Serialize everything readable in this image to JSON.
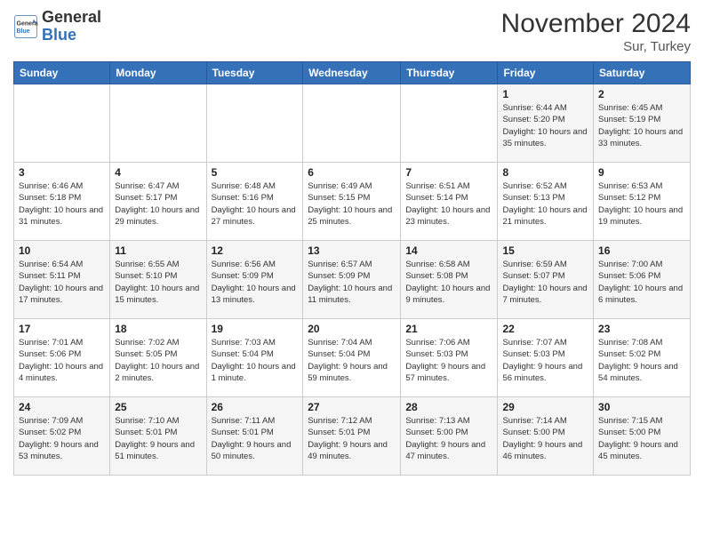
{
  "header": {
    "logo_line1": "General",
    "logo_line2": "Blue",
    "month": "November 2024",
    "location": "Sur, Turkey"
  },
  "calendar": {
    "days_of_week": [
      "Sunday",
      "Monday",
      "Tuesday",
      "Wednesday",
      "Thursday",
      "Friday",
      "Saturday"
    ],
    "weeks": [
      [
        {
          "day": "",
          "info": ""
        },
        {
          "day": "",
          "info": ""
        },
        {
          "day": "",
          "info": ""
        },
        {
          "day": "",
          "info": ""
        },
        {
          "day": "",
          "info": ""
        },
        {
          "day": "1",
          "info": "Sunrise: 6:44 AM\nSunset: 5:20 PM\nDaylight: 10 hours\nand 35 minutes."
        },
        {
          "day": "2",
          "info": "Sunrise: 6:45 AM\nSunset: 5:19 PM\nDaylight: 10 hours\nand 33 minutes."
        }
      ],
      [
        {
          "day": "3",
          "info": "Sunrise: 6:46 AM\nSunset: 5:18 PM\nDaylight: 10 hours\nand 31 minutes."
        },
        {
          "day": "4",
          "info": "Sunrise: 6:47 AM\nSunset: 5:17 PM\nDaylight: 10 hours\nand 29 minutes."
        },
        {
          "day": "5",
          "info": "Sunrise: 6:48 AM\nSunset: 5:16 PM\nDaylight: 10 hours\nand 27 minutes."
        },
        {
          "day": "6",
          "info": "Sunrise: 6:49 AM\nSunset: 5:15 PM\nDaylight: 10 hours\nand 25 minutes."
        },
        {
          "day": "7",
          "info": "Sunrise: 6:51 AM\nSunset: 5:14 PM\nDaylight: 10 hours\nand 23 minutes."
        },
        {
          "day": "8",
          "info": "Sunrise: 6:52 AM\nSunset: 5:13 PM\nDaylight: 10 hours\nand 21 minutes."
        },
        {
          "day": "9",
          "info": "Sunrise: 6:53 AM\nSunset: 5:12 PM\nDaylight: 10 hours\nand 19 minutes."
        }
      ],
      [
        {
          "day": "10",
          "info": "Sunrise: 6:54 AM\nSunset: 5:11 PM\nDaylight: 10 hours\nand 17 minutes."
        },
        {
          "day": "11",
          "info": "Sunrise: 6:55 AM\nSunset: 5:10 PM\nDaylight: 10 hours\nand 15 minutes."
        },
        {
          "day": "12",
          "info": "Sunrise: 6:56 AM\nSunset: 5:09 PM\nDaylight: 10 hours\nand 13 minutes."
        },
        {
          "day": "13",
          "info": "Sunrise: 6:57 AM\nSunset: 5:09 PM\nDaylight: 10 hours\nand 11 minutes."
        },
        {
          "day": "14",
          "info": "Sunrise: 6:58 AM\nSunset: 5:08 PM\nDaylight: 10 hours\nand 9 minutes."
        },
        {
          "day": "15",
          "info": "Sunrise: 6:59 AM\nSunset: 5:07 PM\nDaylight: 10 hours\nand 7 minutes."
        },
        {
          "day": "16",
          "info": "Sunrise: 7:00 AM\nSunset: 5:06 PM\nDaylight: 10 hours\nand 6 minutes."
        }
      ],
      [
        {
          "day": "17",
          "info": "Sunrise: 7:01 AM\nSunset: 5:06 PM\nDaylight: 10 hours\nand 4 minutes."
        },
        {
          "day": "18",
          "info": "Sunrise: 7:02 AM\nSunset: 5:05 PM\nDaylight: 10 hours\nand 2 minutes."
        },
        {
          "day": "19",
          "info": "Sunrise: 7:03 AM\nSunset: 5:04 PM\nDaylight: 10 hours\nand 1 minute."
        },
        {
          "day": "20",
          "info": "Sunrise: 7:04 AM\nSunset: 5:04 PM\nDaylight: 9 hours\nand 59 minutes."
        },
        {
          "day": "21",
          "info": "Sunrise: 7:06 AM\nSunset: 5:03 PM\nDaylight: 9 hours\nand 57 minutes."
        },
        {
          "day": "22",
          "info": "Sunrise: 7:07 AM\nSunset: 5:03 PM\nDaylight: 9 hours\nand 56 minutes."
        },
        {
          "day": "23",
          "info": "Sunrise: 7:08 AM\nSunset: 5:02 PM\nDaylight: 9 hours\nand 54 minutes."
        }
      ],
      [
        {
          "day": "24",
          "info": "Sunrise: 7:09 AM\nSunset: 5:02 PM\nDaylight: 9 hours\nand 53 minutes."
        },
        {
          "day": "25",
          "info": "Sunrise: 7:10 AM\nSunset: 5:01 PM\nDaylight: 9 hours\nand 51 minutes."
        },
        {
          "day": "26",
          "info": "Sunrise: 7:11 AM\nSunset: 5:01 PM\nDaylight: 9 hours\nand 50 minutes."
        },
        {
          "day": "27",
          "info": "Sunrise: 7:12 AM\nSunset: 5:01 PM\nDaylight: 9 hours\nand 49 minutes."
        },
        {
          "day": "28",
          "info": "Sunrise: 7:13 AM\nSunset: 5:00 PM\nDaylight: 9 hours\nand 47 minutes."
        },
        {
          "day": "29",
          "info": "Sunrise: 7:14 AM\nSunset: 5:00 PM\nDaylight: 9 hours\nand 46 minutes."
        },
        {
          "day": "30",
          "info": "Sunrise: 7:15 AM\nSunset: 5:00 PM\nDaylight: 9 hours\nand 45 minutes."
        }
      ]
    ]
  }
}
